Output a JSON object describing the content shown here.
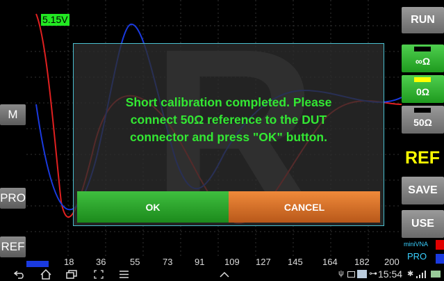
{
  "voltage_label": "5.15V",
  "left_buttons": {
    "m": "M",
    "pro": "PRO",
    "ref": "REF"
  },
  "right_panel": {
    "run": "RUN",
    "cal_open": "∞Ω",
    "cal_short": "0Ω",
    "cal_load": "50Ω",
    "ref": "REF",
    "save": "SAVE",
    "use": "USE",
    "brand_line1": "miniVNA",
    "brand_line2": "PRO"
  },
  "x_ticks": [
    "18",
    "36",
    "55",
    "73",
    "91",
    "109",
    "127",
    "145",
    "164",
    "182",
    "200"
  ],
  "dialog": {
    "line1": "Short calibration completed. Please",
    "line2": "connect 50Ω reference to the DUT",
    "line3": "connector and press \"OK\" button.",
    "ok": "OK",
    "cancel": "CANCEL"
  },
  "status": {
    "time": "15:54"
  },
  "colors": {
    "accent_green": "#33e833",
    "dialog_border": "#4ac0d0",
    "ok": "#2aa52a",
    "cancel": "#e0782c",
    "ref_yellow": "#ffff00"
  }
}
